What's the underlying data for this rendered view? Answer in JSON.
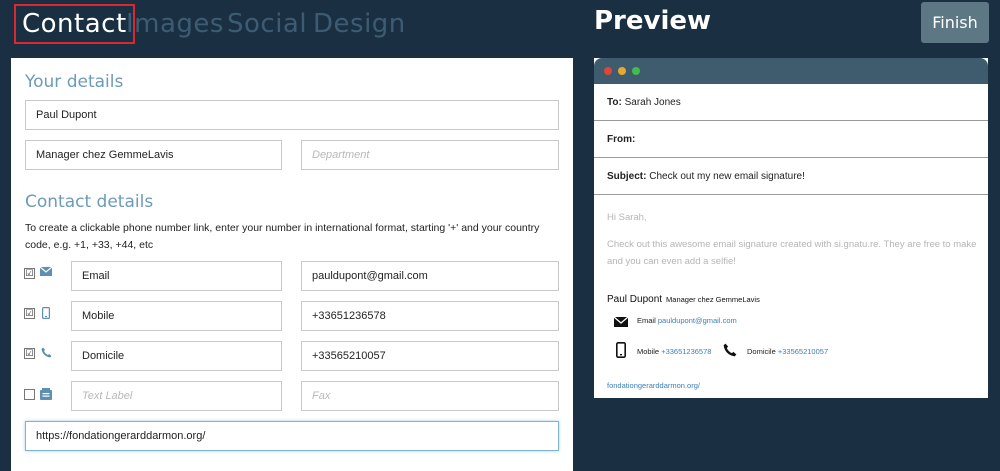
{
  "tabs": [
    {
      "label": "Contact"
    },
    {
      "label": "Images"
    },
    {
      "label": "Social"
    },
    {
      "label": "Design"
    }
  ],
  "preview_title": "Preview",
  "finish_label": "Finish",
  "form": {
    "your_details_title": "Your details",
    "name_value": "Paul Dupont",
    "title_value": "Manager chez GemmeLavis",
    "department_placeholder": "Department",
    "contact_details_title": "Contact details",
    "help_text": "To create a clickable phone number link, enter your number in international format, starting '+' and your country code, e.g. +1, +33, +44, etc",
    "rows": [
      {
        "checked": "☑",
        "icon": "envelope-icon",
        "label": "Email",
        "value": "pauldupont@gmail.com"
      },
      {
        "checked": "☑",
        "icon": "mobile-icon",
        "label": "Mobile",
        "value": "+33651236578"
      },
      {
        "checked": "☑",
        "icon": "phone-icon",
        "label": "Domicile",
        "value": "+33565210057"
      },
      {
        "checked": "",
        "icon": "fax-icon",
        "label_placeholder": "Text Label",
        "value_placeholder": "Fax"
      }
    ],
    "website_value": "https://fondationgerarddarmon.org/"
  },
  "preview": {
    "to_label": "To:",
    "to_value": "Sarah Jones",
    "from_label": "From:",
    "subject_label": "Subject:",
    "subject_value": "Check out my new email signature!",
    "greeting": "Hi Sarah,",
    "message": "Check out this awesome email signature created with si.gnatu.re. They are free to make and you can even add a selfie!",
    "sig_name": "Paul Dupont",
    "sig_role": "Manager chez GemmeLavis",
    "email_label": "Email",
    "email_value": "pauldupont@gmail.com",
    "mobile_label": "Mobile",
    "mobile_value": "+33651236578",
    "domicile_label": "Domicile",
    "domicile_value": "+33565210057",
    "website": "fondationgerarddarmon.org/"
  },
  "colors": {
    "background": "#1a3042",
    "active_tab_border": "#d9282f",
    "inactive_tab": "#3d5c73",
    "section_title": "#6b9bb8",
    "finish_button": "#5d7785",
    "window_bar": "#3e5c6e",
    "dot_red": "#e0443a",
    "dot_yellow": "#e8a92b",
    "dot_green": "#3dbf4a",
    "link": "#3c7fb8"
  }
}
